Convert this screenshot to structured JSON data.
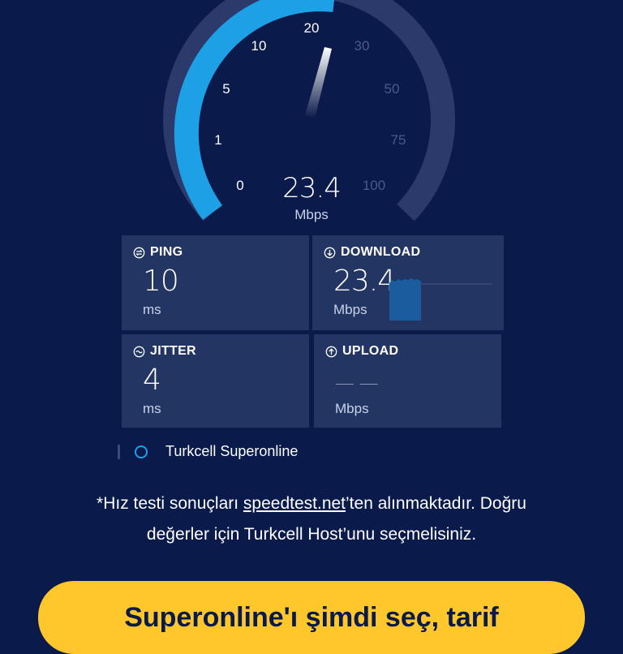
{
  "gauge": {
    "ticks": [
      "0",
      "1",
      "5",
      "10",
      "20",
      "30",
      "50",
      "75",
      "100"
    ],
    "value": "23.4",
    "unit": "Mbps",
    "colors": {
      "active": "#1ea0e6",
      "inactive": "#2b3a6b",
      "needle": "#ffffff"
    }
  },
  "metrics": {
    "ping": {
      "label": "PING",
      "value": "10",
      "unit": "ms"
    },
    "download": {
      "label": "DOWNLOAD",
      "value": "23.4",
      "unit": "Mbps"
    },
    "jitter": {
      "label": "JITTER",
      "value": "4",
      "unit": "ms"
    },
    "upload": {
      "label": "UPLOAD",
      "value": "— —",
      "unit": "Mbps"
    }
  },
  "provider": {
    "name": "Turkcell Superonline"
  },
  "note": {
    "prefix": "*Hız testi sonuçları ",
    "link": "speedtest.net",
    "suffix_line1": "’ten alınmaktadır. Doğru",
    "line2": "değerler için Turkcell Host’unu seçmelisiniz."
  },
  "cta": {
    "label": "Superonline'ı şimdi seç, tarif"
  },
  "colors": {
    "background": "#0a1a4a",
    "card": "#223563",
    "accent": "#1ea0e6",
    "cta": "#ffc72c"
  }
}
